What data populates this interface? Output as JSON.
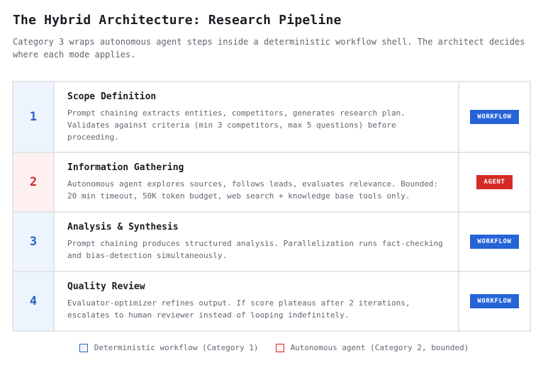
{
  "header": {
    "title": "The Hybrid Architecture: Research Pipeline",
    "subtitle": "Category 3 wraps autonomous agent steps inside a deterministic workflow shell. The architect decides where each mode applies."
  },
  "steps": [
    {
      "number": "1",
      "mode": "workflow",
      "title": "Scope Definition",
      "description": "Prompt chaining extracts entities, competitors, generates research plan. Validates against criteria (min 3 competitors, max 5 questions) before proceeding.",
      "badge": "WORKFLOW"
    },
    {
      "number": "2",
      "mode": "agent",
      "title": "Information Gathering",
      "description": "Autonomous agent explores sources, follows leads, evaluates relevance. Bounded: 20 min timeout, 50K token budget, web search + knowledge base tools only.",
      "badge": "AGENT"
    },
    {
      "number": "3",
      "mode": "workflow",
      "title": "Analysis & Synthesis",
      "description": "Prompt chaining produces structured analysis. Parallelization runs fact-checking and bias-detection simultaneously.",
      "badge": "WORKFLOW"
    },
    {
      "number": "4",
      "mode": "workflow",
      "title": "Quality Review",
      "description": "Evaluator-optimizer refines output. If score plateaus after 2 iterations, escalates to human reviewer instead of looping indefinitely.",
      "badge": "WORKFLOW"
    }
  ],
  "legend": {
    "workflow_label": "Deterministic workflow (Category 1)",
    "agent_label": "Autonomous agent (Category 2, bounded)"
  },
  "colors": {
    "workflow_accent": "#2563d6",
    "agent_accent": "#d42b25",
    "workflow_tint": "#eef4fd",
    "agent_tint": "#fdf0ef"
  }
}
